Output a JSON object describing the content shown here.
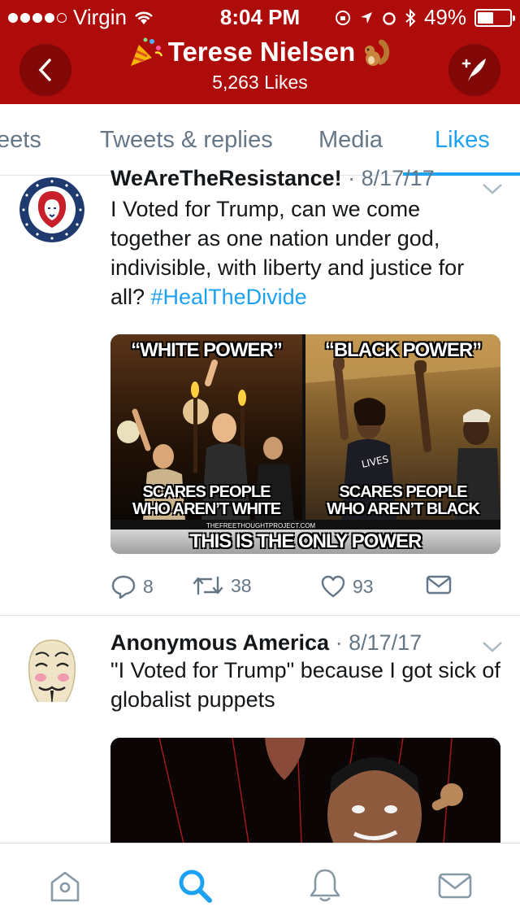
{
  "status_bar": {
    "carrier": "Virgin",
    "time": "8:04 PM",
    "battery": "49%",
    "battery_level": 0.49
  },
  "header": {
    "title": "Terese Nielsen",
    "subtitle": "5,263 Likes",
    "back_icon": "chevron-left-icon",
    "compose_icon": "compose-tweet-icon",
    "accent_color": "#ae0b0b"
  },
  "tabs": [
    {
      "label": "eets",
      "active": false
    },
    {
      "label": "Tweets & replies",
      "active": false
    },
    {
      "label": "Media",
      "active": false
    },
    {
      "label": "Likes",
      "active": true
    }
  ],
  "tweets": [
    {
      "name": "WeAreTheResistance!",
      "date": "8/17/17",
      "text": "I Voted for Trump, can we come together as one nation under god, indivisible, with liberty and justice for all? ",
      "hashtag": "#HealTheDivide",
      "image": {
        "caption_left_top": "“WHITE POWER”",
        "caption_right_top": "“BLACK POWER”",
        "caption_left_bottom_1": "SCARES PEOPLE",
        "caption_left_bottom_2": "WHO AREN’T WHITE",
        "caption_right_bottom_1": "SCARES PEOPLE",
        "caption_right_bottom_2": "WHO AREN’T BLACK",
        "source": "THEFREETHOUGHTPROJECT.COM",
        "banner": "THIS IS THE ONLY POWER"
      },
      "replies": "8",
      "retweets": "38",
      "likes": "93"
    },
    {
      "name": "Anonymous America",
      "date": "8/17/17",
      "text": "\"I Voted for Trump\" because I got sick of globalist puppets"
    }
  ],
  "bottom_bar": [
    {
      "icon": "home-icon"
    },
    {
      "icon": "search-icon",
      "active": true
    },
    {
      "icon": "notifications-bell-icon"
    },
    {
      "icon": "messages-envelope-icon"
    }
  ],
  "colors": {
    "link": "#1da1f2",
    "muted": "#657786"
  }
}
